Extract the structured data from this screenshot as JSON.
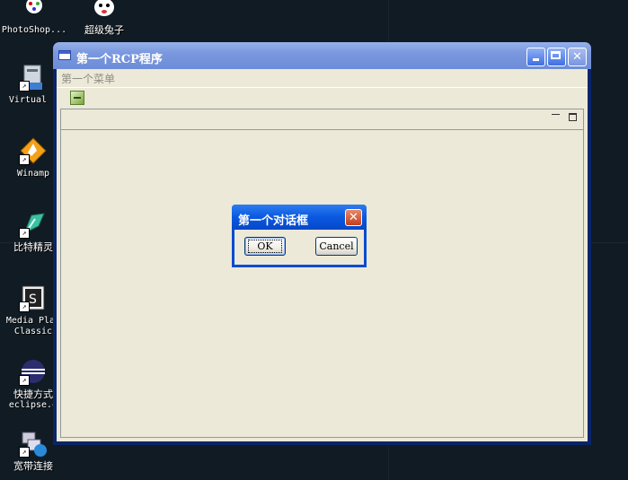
{
  "desktop": {
    "icons": [
      {
        "label": "PhotoShop...",
        "icon": "photoshop-icon"
      },
      {
        "label": "超级兔子",
        "icon": "rabbit-icon"
      },
      {
        "label": "Virtual P",
        "icon": "virtual-pc-icon"
      },
      {
        "label": "Winamp",
        "icon": "winamp-icon"
      },
      {
        "label": "比特精灵",
        "icon": "bitspirit-icon"
      },
      {
        "label": "Media Play",
        "label2": "Classic",
        "icon": "media-player-icon"
      },
      {
        "label": "快捷方式",
        "label2": "eclipse.e",
        "icon": "eclipse-icon"
      },
      {
        "label": "宽带连接",
        "icon": "network-icon"
      }
    ]
  },
  "window": {
    "title": "第一个RCP程序",
    "menu": [
      "第一个菜单"
    ]
  },
  "dialog": {
    "title": "第一个对话框",
    "ok_label": "OK",
    "cancel_label": "Cancel",
    "close_glyph": "✕"
  },
  "colors": {
    "window_title_inactive": "#7a98df",
    "dialog_title_active": "#0a58e0",
    "client_bg": "#ece9d8",
    "desktop_bg": "#101b23"
  }
}
